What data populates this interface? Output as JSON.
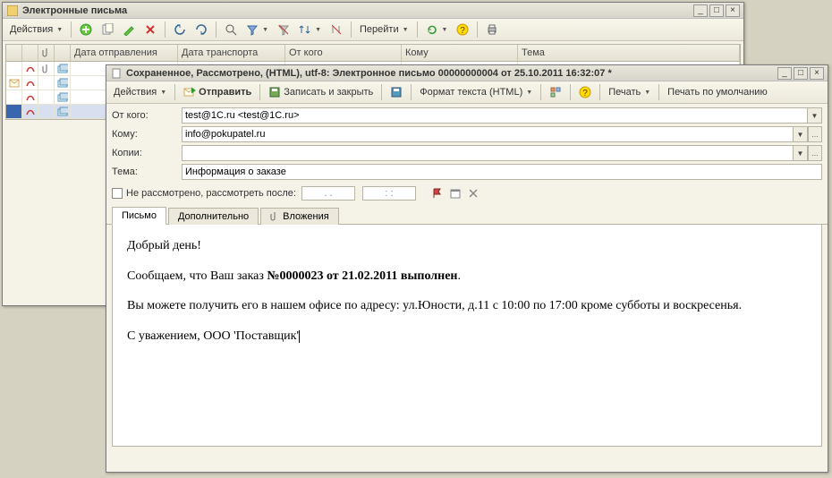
{
  "list_window": {
    "title": "Электронные письма",
    "toolbar": {
      "actions_label": "Действия",
      "goto_label": "Перейти"
    },
    "columns": {
      "c_attach": "",
      "c_clip": "",
      "c_sent_date": "Дата отправления",
      "c_transport_date": "Дата транспорта",
      "c_from": "От кого",
      "c_to": "Кому",
      "c_subject": "Тема"
    }
  },
  "compose_window": {
    "title": "Сохраненное, Рассмотрено,  (HTML), utf-8: Электронное письмо 00000000004 от 25.10.2011 16:32:07 *",
    "toolbar": {
      "actions_label": "Действия",
      "send_label": "Отправить",
      "save_close_label": "Записать и закрыть",
      "format_label": "Формат текста (HTML)",
      "print_label": "Печать",
      "print_default_label": "Печать по умолчанию"
    },
    "fields": {
      "from_label": "От кого:",
      "from_value": "test@1C.ru <test@1C.ru>",
      "to_label": "Кому:",
      "to_value": "info@pokupatel.ru",
      "cc_label": "Копии:",
      "cc_value": "",
      "subject_label": "Тема:",
      "subject_value": "Информация о заказе"
    },
    "review": {
      "label": "Не рассмотрено, рассмотреть после:",
      "date_value": "  .  .",
      "time_value": "  :  :"
    },
    "tabs": {
      "t_body": "Письмо",
      "t_extra": "Дополнительно",
      "t_attach": "Вложения"
    },
    "body": {
      "p1": "Добрый день!",
      "p2a": "Сообщаем, что Ваш заказ ",
      "p2b": "№0000023 от 21.02.2011 выполнен",
      "p2c": ".",
      "p3": "Вы можете получить его в нашем офисе по адресу: ул.Юности, д.11 с 10:00 по 17:00 кроме субботы и воскресенья.",
      "p4": "С уважением, ООО 'Поставщик'"
    }
  }
}
